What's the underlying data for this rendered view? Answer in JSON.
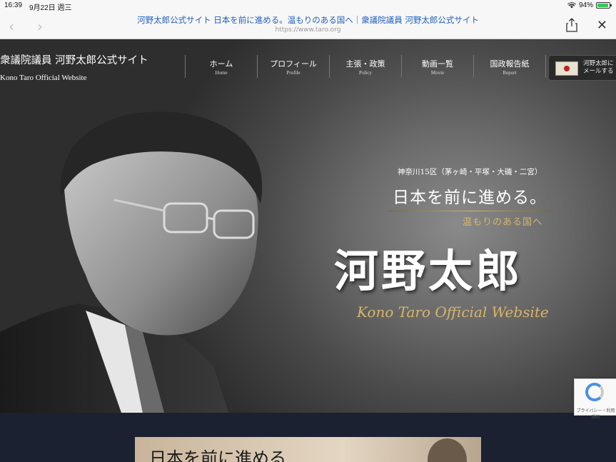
{
  "status_bar": {
    "time": "16:39",
    "date": "9月22日 週三",
    "battery": "94%",
    "battery_level": 0.94
  },
  "browser": {
    "title": "河野太郎公式サイト 日本を前に進める。温もりのある国へ｜衆議院議員 河野太郎公式サイト",
    "url": "https://www.taro.org"
  },
  "site": {
    "title": "衆議院議員 河野太郎公式サイト",
    "subtitle": "Kono Taro Official Website",
    "nav": [
      {
        "label": "ホーム",
        "sub": "Home"
      },
      {
        "label": "プロフィール",
        "sub": "Profile"
      },
      {
        "label": "主張・政策",
        "sub": "Policy"
      },
      {
        "label": "動画一覧",
        "sub": "Movie"
      },
      {
        "label": "国政報告紙",
        "sub": "Report"
      }
    ],
    "mail_button": {
      "line1": "河野太郎に",
      "line2": "メールする"
    }
  },
  "hero": {
    "district": "神奈川15区（茅ヶ崎・平塚・大磯・二宮）",
    "slogan": "日本を前に進める。",
    "subslogan": "温もりのある国へ",
    "name": "河野太郎",
    "english_title": "Kono Taro Official Website"
  },
  "banner": {
    "text": "日本を前に進める"
  },
  "recaptcha": {
    "label": "プライバシー・利用規約"
  }
}
